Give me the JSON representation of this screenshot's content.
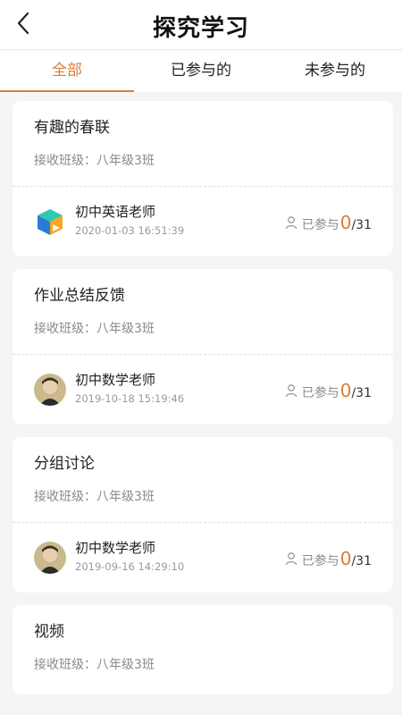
{
  "header": {
    "title": "探究学习"
  },
  "tabs": [
    {
      "label": "全部"
    },
    {
      "label": "已参与的"
    },
    {
      "label": "未参与的"
    }
  ],
  "colors": {
    "accent": "#e07a35"
  },
  "cards": [
    {
      "title": "有趣的春联",
      "class_info": "接收班级：八年级3班",
      "teacher": "初中英语老师",
      "time": "2020-01-03 16:51:39",
      "joined_label": "已参与",
      "joined_count": "0",
      "total": "/31"
    },
    {
      "title": "作业总结反馈",
      "class_info": "接收班级：八年级3班",
      "teacher": "初中数学老师",
      "time": "2019-10-18 15:19:46",
      "joined_label": "已参与",
      "joined_count": "0",
      "total": "/31"
    },
    {
      "title": "分组讨论",
      "class_info": "接收班级：八年级3班",
      "teacher": "初中数学老师",
      "time": "2019-09-16 14:29:10",
      "joined_label": "已参与",
      "joined_count": "0",
      "total": "/31"
    },
    {
      "title": "视频",
      "class_info": "接收班级：八年级3班"
    }
  ]
}
